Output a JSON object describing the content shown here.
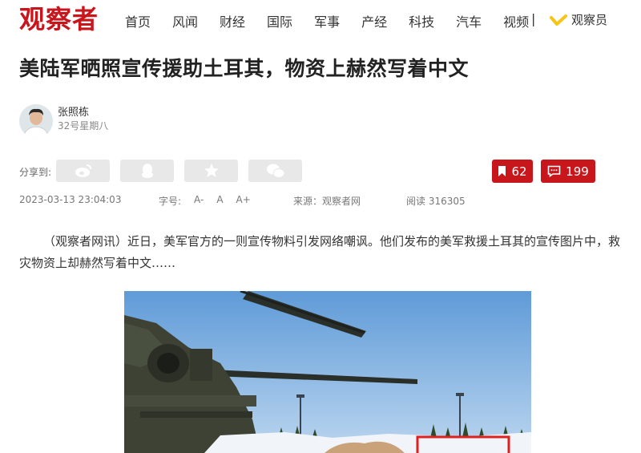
{
  "site": {
    "logo": "观察者"
  },
  "nav": {
    "items": [
      "首页",
      "风闻",
      "财经",
      "国际",
      "军事",
      "产经",
      "科技",
      "汽车",
      "视频"
    ],
    "separator": "|",
    "member_label": "观察员"
  },
  "article": {
    "title": "美陆军晒照宣传援助土耳其，物资上赫然写着中文",
    "author": {
      "name": "张照栋",
      "subtitle": "32号星期八"
    },
    "share": {
      "label": "分享到:",
      "buttons": [
        "weibo-icon",
        "qq-icon",
        "qzone-star-icon",
        "wechat-icon"
      ]
    },
    "counts": {
      "bookmarks": "62",
      "comments": "199"
    },
    "meta": {
      "datetime": "2023-03-13 23:04:03",
      "font_size_label": "字号:",
      "font_sizes": [
        "A-",
        "A",
        "A+"
      ],
      "source": "来源：观察者网",
      "reads": "阅读 316305"
    },
    "paragraph": "（观察者网讯）近日，美军官方的一则宣传物料引发网络嘲讽。他们发布的美军救援土耳其的宣传图片中，救灾物资上却赫然写着中文……"
  },
  "colors": {
    "brand_red": "#c8161d",
    "button_gray": "#e8e8e8",
    "member_gold": "#f5c518"
  }
}
